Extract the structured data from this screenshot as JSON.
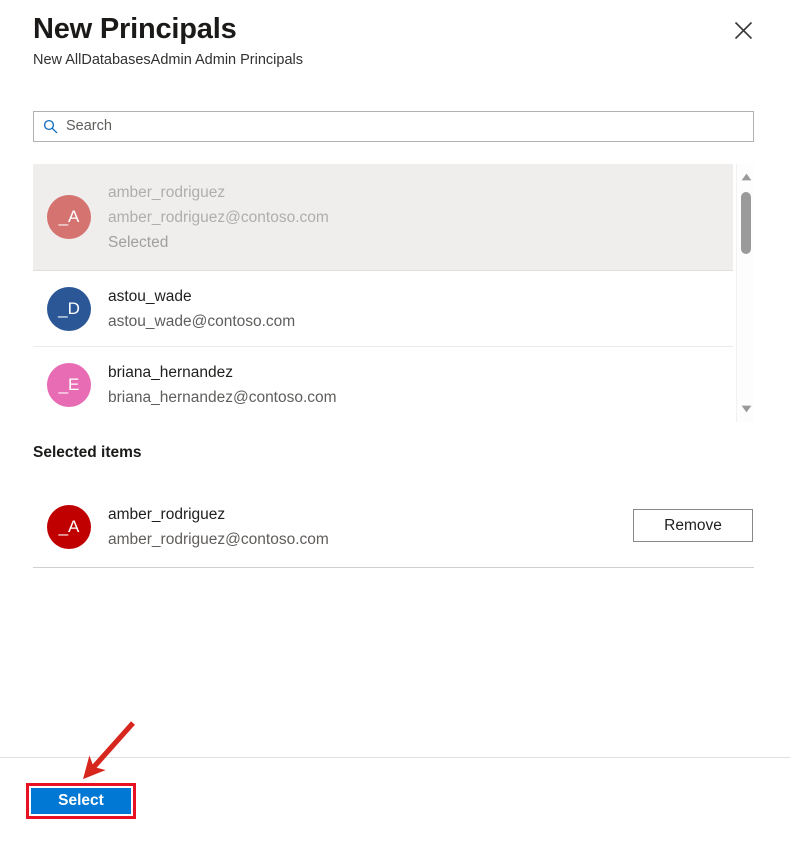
{
  "panel": {
    "title": "New Principals",
    "subtitle": "New AllDatabasesAdmin Admin Principals",
    "close_icon": "close-icon"
  },
  "search": {
    "icon": "search-icon",
    "value": "",
    "placeholder": "Search"
  },
  "results": {
    "scrollbar": {
      "up_arrow_icon": "chevron-up-icon",
      "down_arrow_icon": "chevron-down-icon"
    },
    "items": [
      {
        "initials": "_A",
        "name": "amber_rodriguez",
        "email": "amber_rodriguez@contoso.com",
        "status": "Selected",
        "avatar_color": "#d4736f",
        "disabled": true
      },
      {
        "initials": "_D",
        "name": "astou_wade",
        "email": "astou_wade@contoso.com",
        "status": "",
        "avatar_color": "#2b5797",
        "disabled": false
      },
      {
        "initials": "_E",
        "name": "briana_hernandez",
        "email": "briana_hernandez@contoso.com",
        "status": "",
        "avatar_color": "#e86cb4",
        "disabled": false
      }
    ]
  },
  "selected": {
    "heading": "Selected items",
    "items": [
      {
        "initials": "_A",
        "name": "amber_rodriguez",
        "email": "amber_rodriguez@contoso.com",
        "avatar_color": "#c00000",
        "remove_label": "Remove"
      }
    ]
  },
  "footer": {
    "select_label": "Select"
  },
  "annotations": {
    "highlight_color": "#e81123",
    "arrow_color": "#d7261e",
    "accent_color": "#0078d4"
  }
}
